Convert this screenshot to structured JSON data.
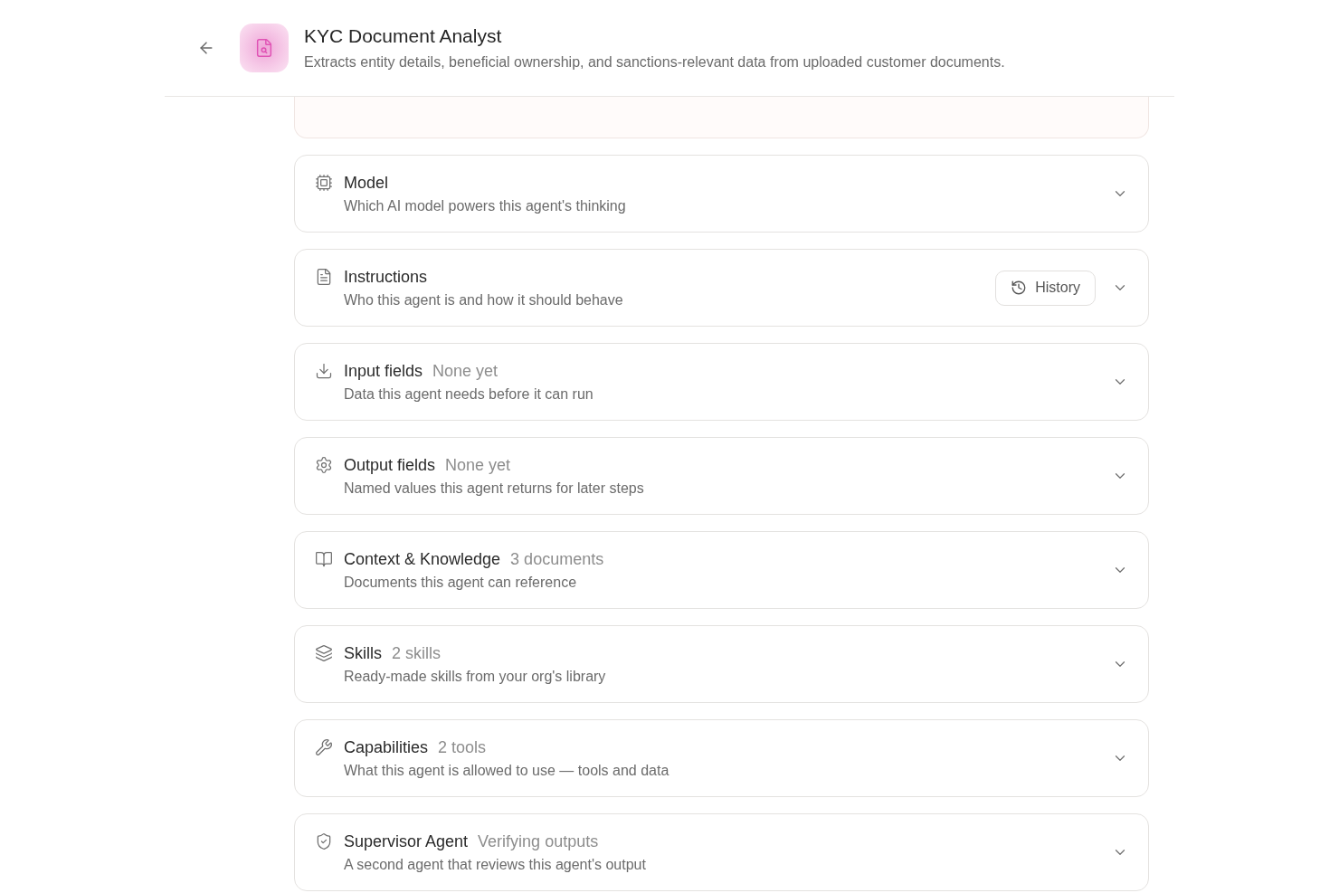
{
  "header": {
    "title": "KYC Document Analyst",
    "description": "Extracts entity details, beneficial ownership, and sanctions-relevant data from uploaded customer documents."
  },
  "sections": [
    {
      "kind": "model",
      "title": "Model",
      "subtitle": "Which AI model powers this agent's thinking",
      "expanded": false
    },
    {
      "kind": "instructions",
      "title": "Instructions",
      "subtitle": "Who this agent is and how it should behave",
      "action": "History",
      "expanded": false
    },
    {
      "kind": "inputs",
      "title": "Input fields",
      "badge": "None yet",
      "subtitle": "Data this agent needs before it can run",
      "expanded": false
    },
    {
      "kind": "outputs",
      "title": "Output fields",
      "badge": "None yet",
      "subtitle": "Named values this agent returns for later steps",
      "expanded": false
    },
    {
      "kind": "knowledge",
      "title": "Context & Knowledge",
      "badge": "3 documents",
      "subtitle": "Documents this agent can reference",
      "expanded": false
    },
    {
      "kind": "skills",
      "title": "Skills",
      "badge": "2 skills",
      "subtitle": "Ready-made skills from your org's library",
      "expanded": false
    },
    {
      "kind": "capabilities",
      "title": "Capabilities",
      "badge": "2 tools",
      "subtitle": "What this agent is allowed to use — tools and data",
      "expanded": false
    },
    {
      "kind": "supervisor",
      "title": "Supervisor Agent",
      "badge": "Verifying outputs",
      "subtitle": "A second agent that reviews this agent's output",
      "expanded": false
    }
  ]
}
